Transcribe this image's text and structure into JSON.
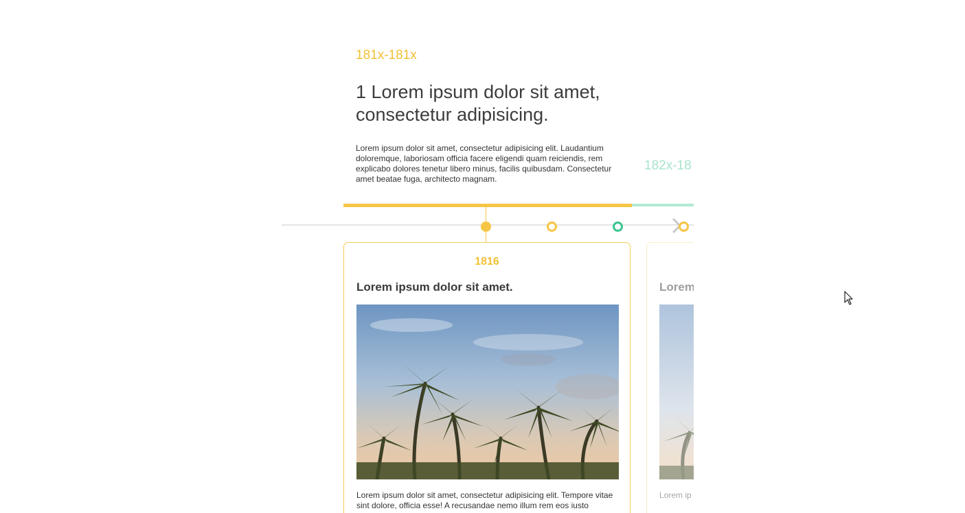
{
  "section": {
    "active_range": "181x-181x",
    "headline": "1 Lorem ipsum dolor sit amet, consectetur adipisicing.",
    "intro": "Lorem ipsum dolor sit amet, consectetur adipisicing elit. Laudantium doloremque, laboriosam officia facere eligendi quam reiciendis, rem explicabo dolores tenetur libero minus, facilis quibusdam. Consectetur amet beatae fuga, architecto magnam.",
    "next_range": "182x-18"
  },
  "progress": {
    "active_color": "#f7c544",
    "next_color": "#b1ead2"
  },
  "timeline": {
    "dots": [
      {
        "state": "active",
        "color": "#f7c544"
      },
      {
        "state": "inactive",
        "color": "#f7c544"
      },
      {
        "state": "inactive",
        "color": "#3cc48f"
      },
      {
        "state": "inactive",
        "color": "#f7c544"
      }
    ],
    "next_icon": "chevron-right-icon"
  },
  "cards": [
    {
      "year": "1816",
      "title": "Lorem ipsum dolor sit amet.",
      "image": "palm-trees-sunset-photo",
      "text": "Lorem ipsum dolor sit amet, consectetur adipisicing elit. Tempore vitae sint dolore, officia esse! A recusandae nemo illum rem eos iusto"
    },
    {
      "year": "",
      "title": "Lorem",
      "image": "palm-trees-sunset-photo",
      "text": "Lorem ip vitae sint"
    }
  ],
  "colors": {
    "accent_yellow": "#f2c035",
    "accent_green": "#3cc48f"
  }
}
